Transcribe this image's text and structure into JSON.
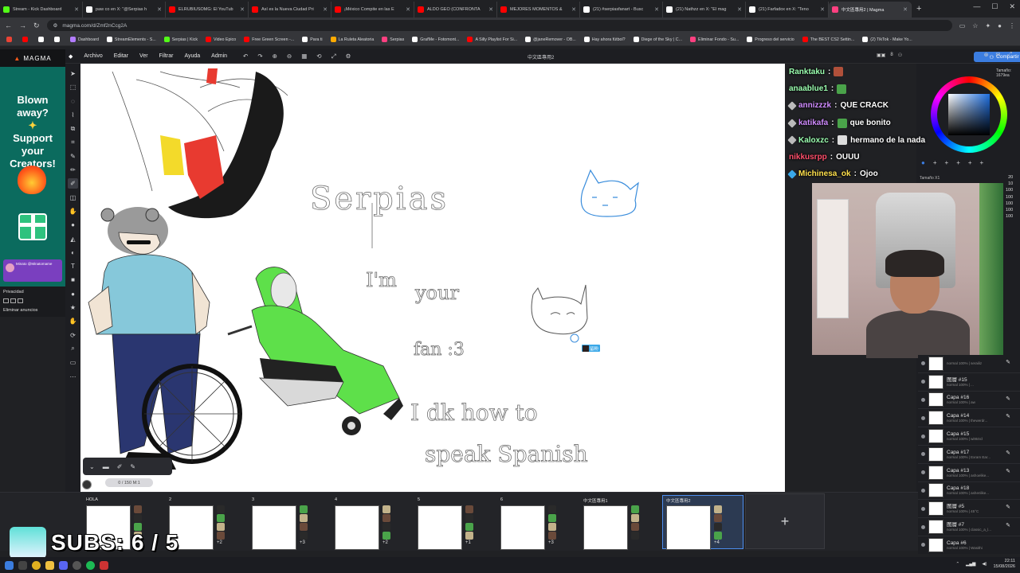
{
  "browser": {
    "tabs": [
      {
        "title": "Stream - Kick Dashboard",
        "color": "#53fc18"
      },
      {
        "title": "paw co en X: \"@Serpias h",
        "color": "#ffffff"
      },
      {
        "title": "ELRUBIUSOMG: El YouTub",
        "color": "#ff0000"
      },
      {
        "title": "Así es la Nueva Ciudad Pri",
        "color": "#ff0000"
      },
      {
        "title": "¡México Compite en las E",
        "color": "#ff0000"
      },
      {
        "title": "ALDO GEO (CONFRONTA",
        "color": "#ff0000"
      },
      {
        "title": "MEJORES MOMENTOS &",
        "color": "#ff0000"
      },
      {
        "title": "(21) #serpiasfanart - Busc",
        "color": "#ffffff"
      },
      {
        "title": "(21) Nathzz en X: \"El mag",
        "color": "#ffffff"
      },
      {
        "title": "(21) Farfadox en X: \"Teno",
        "color": "#ffffff"
      },
      {
        "title": "中文區專用2 | Magma",
        "color": "#ff4081"
      }
    ],
    "active_tab": 10,
    "new_tab": "+",
    "url": "magma.com/d/Zmf2nCcg2A",
    "bookmarks": [
      {
        "label": "",
        "color": "#ea4335"
      },
      {
        "label": "",
        "color": "#ff0000"
      },
      {
        "label": "",
        "color": "#ffffff"
      },
      {
        "label": "",
        "color": "#ffffff"
      },
      {
        "label": "Dashboard",
        "color": "#b27cff"
      },
      {
        "label": "StreamElements - S...",
        "color": "#ffffff"
      },
      {
        "label": "Serpias | Kick",
        "color": "#53fc18"
      },
      {
        "label": "Video Epico",
        "color": "#ff0000"
      },
      {
        "label": "Free Green Screen -...",
        "color": "#ff0000"
      },
      {
        "label": "Para ti",
        "color": "#ffffff"
      },
      {
        "label": "La Ruleta Aleatoria",
        "color": "#ffaa00"
      },
      {
        "label": "Serpias",
        "color": "#ff4081"
      },
      {
        "label": "GrafMe - Fotomont...",
        "color": "#ffffff"
      },
      {
        "label": "A Silly Playlist For Si...",
        "color": "#ff0000"
      },
      {
        "label": "@janeRemover - OB...",
        "color": "#ffffff"
      },
      {
        "label": "Hay ahora fútbol?",
        "color": "#ffffff"
      },
      {
        "label": "Diege of the Sky | C...",
        "color": "#ffffff"
      },
      {
        "label": "Eliminar Fondo - Su...",
        "color": "#ff4081"
      },
      {
        "label": "Progreso del servicio",
        "color": "#ffffff"
      },
      {
        "label": "The BEST CS2 Settin...",
        "color": "#ff0000"
      },
      {
        "label": "(2) TikTok - Make Yo...",
        "color": "#ffffff"
      }
    ]
  },
  "ad": {
    "brand": "MAGMA",
    "line1": "Blown",
    "line2": "away?",
    "line3": "Support",
    "line4": "your",
    "line5": "Creators!",
    "privacy": "Privacidad",
    "remove_ads": "Eliminar anuncios",
    "card_name": "Minato @Minatomame"
  },
  "magma": {
    "menus": [
      "Archivo",
      "Editar",
      "Ver",
      "Filtrar",
      "Ayuda",
      "Admin"
    ],
    "doc_title": "中文區專用2",
    "users_count": "8",
    "share_label": "Compartir",
    "zoom_pill": "0 / 150  M:1",
    "user_tag": "留粉"
  },
  "canvas_texts": {
    "serpias": "Serpias",
    "im": "I'm",
    "your": "your",
    "fan": "fan :3",
    "idk": "I dk how to",
    "speak": "speak Spanish"
  },
  "chat": [
    {
      "user": "Ranktaku",
      "color": "#9bffb0",
      "text": "",
      "emote": "#b0503a"
    },
    {
      "user": "anaablue1",
      "color": "#9bffb0",
      "text": "",
      "emote": "#4aa34a"
    },
    {
      "user": "annizzzk",
      "color": "#d08cff",
      "text": "QUE CRACK",
      "emote": ""
    },
    {
      "user": "katikafa",
      "color": "#d08cff",
      "text": "que bonito",
      "emote": "#4aa34a"
    },
    {
      "user": "Kaloxzc",
      "color": "#9bffb0",
      "text": "hermano de la nada",
      "emote": "#dddddd"
    },
    {
      "user": "nikkusrpp",
      "color": "#ff4f6b",
      "text": "OUUU",
      "emote": ""
    },
    {
      "user": "Michinesa_ok",
      "color": "#ffe14d",
      "text": "Ojoo",
      "emote": ""
    }
  ],
  "color_panel": {
    "size_label": "Tamaño: 1679ea",
    "size_caption": "Tamaño X1",
    "brush_sizes": [
      "20",
      "10",
      "100",
      "100",
      "100",
      "100",
      "100"
    ]
  },
  "layers": [
    {
      "name": "",
      "sub": "normal 100% | serailiz"
    },
    {
      "name": "图層 #15",
      "sub": "normal 100% | ..."
    },
    {
      "name": "Capa #16",
      "sub": "normal 100% | aw"
    },
    {
      "name": "Capa #14",
      "sub": "normal 100% | thewerdr..."
    },
    {
      "name": "Capa #15",
      "sub": "normal 100% | wi9t4rd"
    },
    {
      "name": "Capa #17",
      "sub": "normal 100% | Exram Ear..."
    },
    {
      "name": "Capa #13",
      "sub": "normal 100% | ashoelike..."
    },
    {
      "name": "Capa #18",
      "sub": "normal 100% | ashenlike..."
    },
    {
      "name": "图層 #5",
      "sub": "normal 100% | 45°C"
    },
    {
      "name": "图層 #7",
      "sub": "normal 100% | classic_a_l..."
    },
    {
      "name": "Capa #6",
      "sub": "normal 100% | Wasithi"
    },
    {
      "name": "图層 #11",
      "sub": "normal 100%"
    }
  ],
  "boards": [
    {
      "label": "HOLA",
      "more": ""
    },
    {
      "label": "2",
      "more": "+2"
    },
    {
      "label": "3",
      "more": "+3"
    },
    {
      "label": "4",
      "more": "+2"
    },
    {
      "label": "5",
      "more": "+1"
    },
    {
      "label": "6",
      "more": "+3"
    },
    {
      "label": "中文區專用1",
      "more": ""
    },
    {
      "label": "中文區專用2",
      "more": "+4"
    }
  ],
  "overlay": {
    "subs": "SUBS: 6 / 5"
  },
  "taskbar": {
    "time": "22:11",
    "date": "15/08/2026"
  }
}
